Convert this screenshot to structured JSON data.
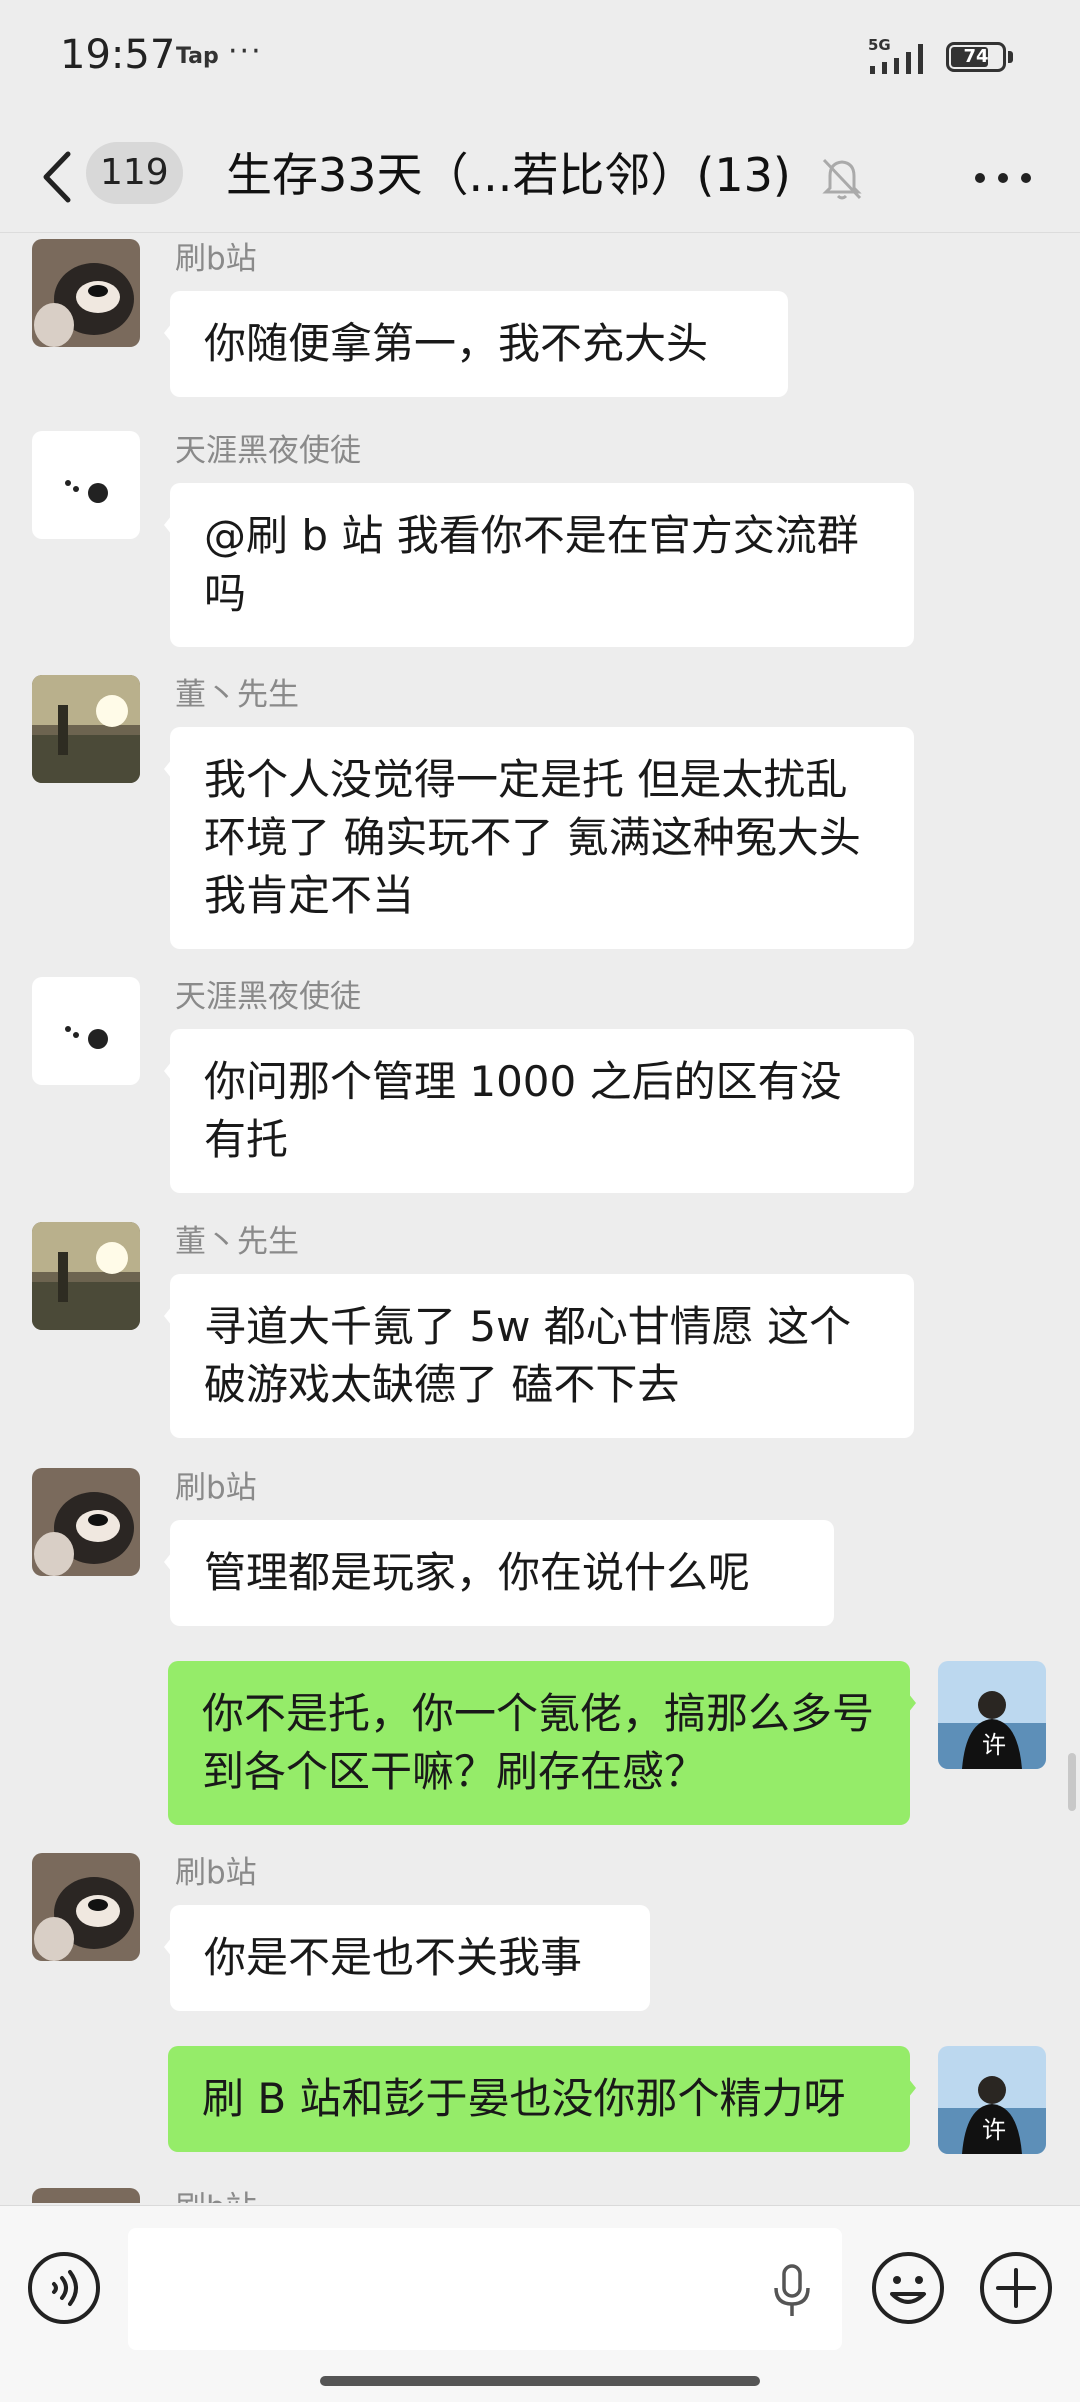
{
  "status_bar": {
    "time": "19:57",
    "tap_label": "Tap",
    "dots": "···",
    "network": "5G",
    "battery": "74"
  },
  "header": {
    "unread_count": "119",
    "title": "生存33天（...若比邻）(13)"
  },
  "messages": [
    {
      "sender": "刷b站",
      "text": "你随便拿第一，我不充大头",
      "side": "left",
      "avatar": "dog-avatar"
    },
    {
      "sender": "天涯黑夜使徒",
      "text": "@刷 b 站  我看你不是在官方交流群吗",
      "side": "left",
      "avatar": "dots-avatar"
    },
    {
      "sender": "董丶先生",
      "text": "我个人没觉得一定是托 但是太扰乱环境了 确实玩不了 氪满这种冤大头我肯定不当",
      "side": "left",
      "avatar": "landscape-avatar"
    },
    {
      "sender": "天涯黑夜使徒",
      "text": "你问那个管理 1000 之后的区有没有托",
      "side": "left",
      "avatar": "dots-avatar"
    },
    {
      "sender": "董丶先生",
      "text": "寻道大千氪了 5w 都心甘情愿 这个破游戏太缺德了 磕不下去",
      "side": "left",
      "avatar": "landscape-avatar"
    },
    {
      "sender": "刷b站",
      "text": "管理都是玩家，你在说什么呢",
      "side": "left",
      "avatar": "dog-avatar"
    },
    {
      "sender": "",
      "text": "你不是托，你一个氪佬，搞那么多号到各个区干嘛？刷存在感？",
      "side": "right",
      "avatar": "self-avatar"
    },
    {
      "sender": "刷b站",
      "text": "你是不是也不关我事",
      "side": "left",
      "avatar": "dog-avatar"
    },
    {
      "sender": "",
      "text": "刷 B 站和彭于晏也没你那个精力呀",
      "side": "right",
      "avatar": "self-avatar"
    },
    {
      "sender": "刷b站",
      "text": "",
      "side": "left",
      "avatar": "dog-avatar"
    }
  ],
  "colors": {
    "background": "#ededed",
    "incoming_bubble": "#ffffff",
    "outgoing_bubble": "#95ec69",
    "sender_name": "#8a8a8a"
  },
  "icons": {
    "back": "chevron-left-icon",
    "mute": "bell-off-icon",
    "more": "more-dots-icon",
    "voice": "voice-icon",
    "mic": "microphone-icon",
    "emoji": "emoji-icon",
    "plus": "plus-icon"
  }
}
